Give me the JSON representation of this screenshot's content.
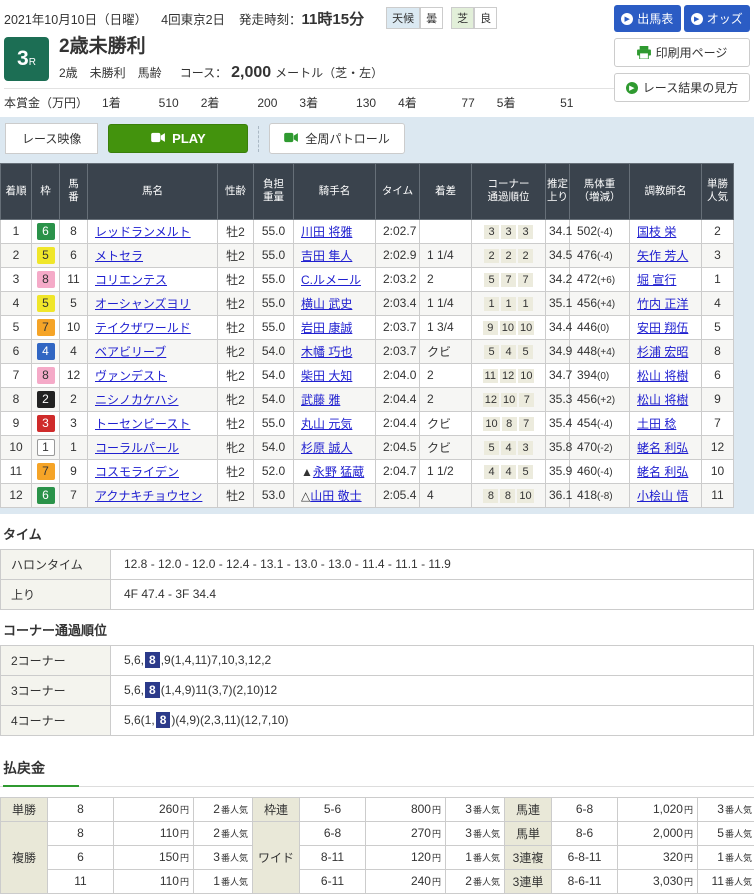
{
  "colors": {
    "accent_blue": "#2b5cc4",
    "play_green": "#43930d",
    "race_badge_green": "#1c6e54",
    "table_header_dark": "#3a434d",
    "band_blue": "#dce8f1",
    "highlight_navy": "#2b3a8a",
    "link_blue": "#2020d0",
    "payout_label_beige": "#e9e8d8",
    "payout_underline_green": "#2f9a30",
    "frame_colors": {
      "1": "#ffffff",
      "2": "#222222",
      "3": "#cf2b2b",
      "4": "#3166c3",
      "5": "#f0e62a",
      "6": "#2a9249",
      "7": "#f5a427",
      "8": "#f5aac8"
    }
  },
  "topbar": {
    "date": "2021年10月10日（日曜）",
    "meeting": "4回東京2日",
    "start_label": "発走時刻：",
    "start_time": "11時15分",
    "weather_label": "天候",
    "weather_value": "曇",
    "turf_label": "芝",
    "turf_value": "良"
  },
  "race": {
    "number": "3",
    "number_suffix": "R",
    "title": "2歳未勝利",
    "meta": "2歳　未勝利　馬齢",
    "course_label": "コース：",
    "course_value": "2,000",
    "course_unit": "メートル（芝・左）",
    "prize_label": "本賞金（万円）",
    "prize_items": [
      {
        "place": "1着",
        "amount": "510"
      },
      {
        "place": "2着",
        "amount": "200"
      },
      {
        "place": "3着",
        "amount": "130"
      },
      {
        "place": "4着",
        "amount": "77"
      },
      {
        "place": "5着",
        "amount": "51"
      }
    ]
  },
  "actions": {
    "entries": "出馬表",
    "odds": "オッズ",
    "print": "印刷用ページ",
    "guide": "レース結果の見方"
  },
  "video_bar": {
    "label": "レース映像",
    "play": "PLAY",
    "patrol": "全周パトロール"
  },
  "results": {
    "columns": [
      "着順",
      "枠",
      "馬\n番",
      "馬名",
      "性齢",
      "負担\n重量",
      "騎手名",
      "タイム",
      "着差",
      "コーナー\n通過順位",
      "推定上り",
      "馬体重\n（増減）",
      "調教師名",
      "単勝\n人気"
    ],
    "rows": [
      {
        "pos": "1",
        "frame": "6",
        "num": "8",
        "horse": "レッドランメルト",
        "sex_age": "牡2",
        "weight": "55.0",
        "mark": "",
        "jockey": "川田 将雅",
        "time": "2:02.7",
        "margin": "",
        "c1": "3",
        "c2": "3",
        "c3": "3",
        "last3f": "34.1",
        "body": "502",
        "diff": "(-4)",
        "trainer": "国枝 栄",
        "pop": "2"
      },
      {
        "pos": "2",
        "frame": "5",
        "num": "6",
        "horse": "メトセラ",
        "sex_age": "牡2",
        "weight": "55.0",
        "mark": "",
        "jockey": "吉田 隼人",
        "time": "2:02.9",
        "margin": "1 1/4",
        "c1": "2",
        "c2": "2",
        "c3": "2",
        "last3f": "34.5",
        "body": "476",
        "diff": "(-4)",
        "trainer": "矢作 芳人",
        "pop": "3"
      },
      {
        "pos": "3",
        "frame": "8",
        "num": "11",
        "horse": "コリエンテス",
        "sex_age": "牡2",
        "weight": "55.0",
        "mark": "",
        "jockey": "C.ルメール",
        "time": "2:03.2",
        "margin": "2",
        "c1": "5",
        "c2": "7",
        "c3": "7",
        "last3f": "34.2",
        "body": "472",
        "diff": "(+6)",
        "trainer": "堀 宣行",
        "pop": "1"
      },
      {
        "pos": "4",
        "frame": "5",
        "num": "5",
        "horse": "オーシャンズヨリ",
        "sex_age": "牡2",
        "weight": "55.0",
        "mark": "",
        "jockey": "横山 武史",
        "time": "2:03.4",
        "margin": "1 1/4",
        "c1": "1",
        "c2": "1",
        "c3": "1",
        "last3f": "35.1",
        "body": "456",
        "diff": "(+4)",
        "trainer": "竹内 正洋",
        "pop": "4"
      },
      {
        "pos": "5",
        "frame": "7",
        "num": "10",
        "horse": "テイクザワールド",
        "sex_age": "牡2",
        "weight": "55.0",
        "mark": "",
        "jockey": "岩田 康誠",
        "time": "2:03.7",
        "margin": "1 3/4",
        "c1": "9",
        "c2": "10",
        "c3": "10",
        "last3f": "34.4",
        "body": "446",
        "diff": "(0)",
        "trainer": "安田 翔伍",
        "pop": "5"
      },
      {
        "pos": "6",
        "frame": "4",
        "num": "4",
        "horse": "ベアビリーブ",
        "sex_age": "牝2",
        "weight": "54.0",
        "mark": "",
        "jockey": "木幡 巧也",
        "time": "2:03.7",
        "margin": "クビ",
        "c1": "5",
        "c2": "4",
        "c3": "5",
        "last3f": "34.9",
        "body": "448",
        "diff": "(+4)",
        "trainer": "杉浦 宏昭",
        "pop": "8"
      },
      {
        "pos": "7",
        "frame": "8",
        "num": "12",
        "horse": "ヴァンデスト",
        "sex_age": "牝2",
        "weight": "54.0",
        "mark": "",
        "jockey": "柴田 大知",
        "time": "2:04.0",
        "margin": "2",
        "c1": "11",
        "c2": "12",
        "c3": "10",
        "last3f": "34.7",
        "body": "394",
        "diff": "(0)",
        "trainer": "松山 将樹",
        "pop": "6"
      },
      {
        "pos": "8",
        "frame": "2",
        "num": "2",
        "horse": "ニシノカケハシ",
        "sex_age": "牝2",
        "weight": "54.0",
        "mark": "",
        "jockey": "武藤 雅",
        "time": "2:04.4",
        "margin": "2",
        "c1": "12",
        "c2": "10",
        "c3": "7",
        "last3f": "35.3",
        "body": "456",
        "diff": "(+2)",
        "trainer": "松山 将樹",
        "pop": "9"
      },
      {
        "pos": "9",
        "frame": "3",
        "num": "3",
        "horse": "トーセンビースト",
        "sex_age": "牡2",
        "weight": "55.0",
        "mark": "",
        "jockey": "丸山 元気",
        "time": "2:04.4",
        "margin": "クビ",
        "c1": "10",
        "c2": "8",
        "c3": "7",
        "last3f": "35.4",
        "body": "454",
        "diff": "(-4)",
        "trainer": "土田 稔",
        "pop": "7"
      },
      {
        "pos": "10",
        "frame": "1",
        "num": "1",
        "horse": "コーラルパール",
        "sex_age": "牝2",
        "weight": "54.0",
        "mark": "",
        "jockey": "杉原 誠人",
        "time": "2:04.5",
        "margin": "クビ",
        "c1": "5",
        "c2": "4",
        "c3": "3",
        "last3f": "35.8",
        "body": "470",
        "diff": "(-2)",
        "trainer": "蛯名 利弘",
        "pop": "12"
      },
      {
        "pos": "11",
        "frame": "7",
        "num": "9",
        "horse": "コスモライデン",
        "sex_age": "牡2",
        "weight": "52.0",
        "mark": "▲",
        "jockey": "永野 猛蔵",
        "time": "2:04.7",
        "margin": "1 1/2",
        "c1": "4",
        "c2": "4",
        "c3": "5",
        "last3f": "35.9",
        "body": "460",
        "diff": "(-4)",
        "trainer": "蛯名 利弘",
        "pop": "10"
      },
      {
        "pos": "12",
        "frame": "6",
        "num": "7",
        "horse": "アクナキチョウセン",
        "sex_age": "牡2",
        "weight": "53.0",
        "mark": "△",
        "jockey": "山田 敬士",
        "time": "2:05.4",
        "margin": "4",
        "c1": "8",
        "c2": "8",
        "c3": "10",
        "last3f": "36.1",
        "body": "418",
        "diff": "(-8)",
        "trainer": "小桧山 悟",
        "pop": "11"
      }
    ]
  },
  "time_section": {
    "title": "タイム",
    "rows": [
      {
        "label": "ハロンタイム",
        "value": "12.8 - 12.0 - 12.0 - 12.4 - 13.1 - 13.0 - 13.0 - 11.4 - 11.1 - 11.9"
      },
      {
        "label": "上り",
        "value": "4F 47.4 - 3F 34.4"
      }
    ]
  },
  "corner_section": {
    "title": "コーナー通過順位",
    "rows": [
      {
        "label": "2コーナー",
        "prefix": "5,6,",
        "highlight": "8",
        "suffix": ",9(1,4,11)7,10,3,12,2"
      },
      {
        "label": "3コーナー",
        "prefix": "5,6,",
        "highlight": "8",
        "suffix": "(1,4,9)11(3,7)(2,10)12"
      },
      {
        "label": "4コーナー",
        "prefix": "5,6(1,",
        "highlight": "8",
        "suffix": ")(4,9)(2,3,11)(12,7,10)"
      }
    ]
  },
  "payouts": {
    "title": "払戻金",
    "yen": "円",
    "ninki": "番人気",
    "tansho": {
      "label": "単勝",
      "combo": "8",
      "amount": "260",
      "pop": "2"
    },
    "fukusho": {
      "label": "複勝",
      "rows": [
        {
          "combo": "8",
          "amount": "110",
          "pop": "2"
        },
        {
          "combo": "6",
          "amount": "150",
          "pop": "3"
        },
        {
          "combo": "11",
          "amount": "110",
          "pop": "1"
        }
      ]
    },
    "wakuren": {
      "label": "枠連",
      "combo": "5-6",
      "amount": "800",
      "pop": "3"
    },
    "wide": {
      "label": "ワイド",
      "rows": [
        {
          "combo": "6-8",
          "amount": "270",
          "pop": "3"
        },
        {
          "combo": "8-11",
          "amount": "120",
          "pop": "1"
        },
        {
          "combo": "6-11",
          "amount": "240",
          "pop": "2"
        }
      ]
    },
    "umaren": {
      "label": "馬連",
      "combo": "6-8",
      "amount": "1,020",
      "pop": "3"
    },
    "umatan": {
      "label": "馬単",
      "combo": "8-6",
      "amount": "2,000",
      "pop": "5"
    },
    "sanrenpuku": {
      "label": "3連複",
      "combo": "6-8-11",
      "amount": "320",
      "pop": "1"
    },
    "sanrentan": {
      "label": "3連単",
      "combo": "8-6-11",
      "amount": "3,030",
      "pop": "11"
    }
  }
}
